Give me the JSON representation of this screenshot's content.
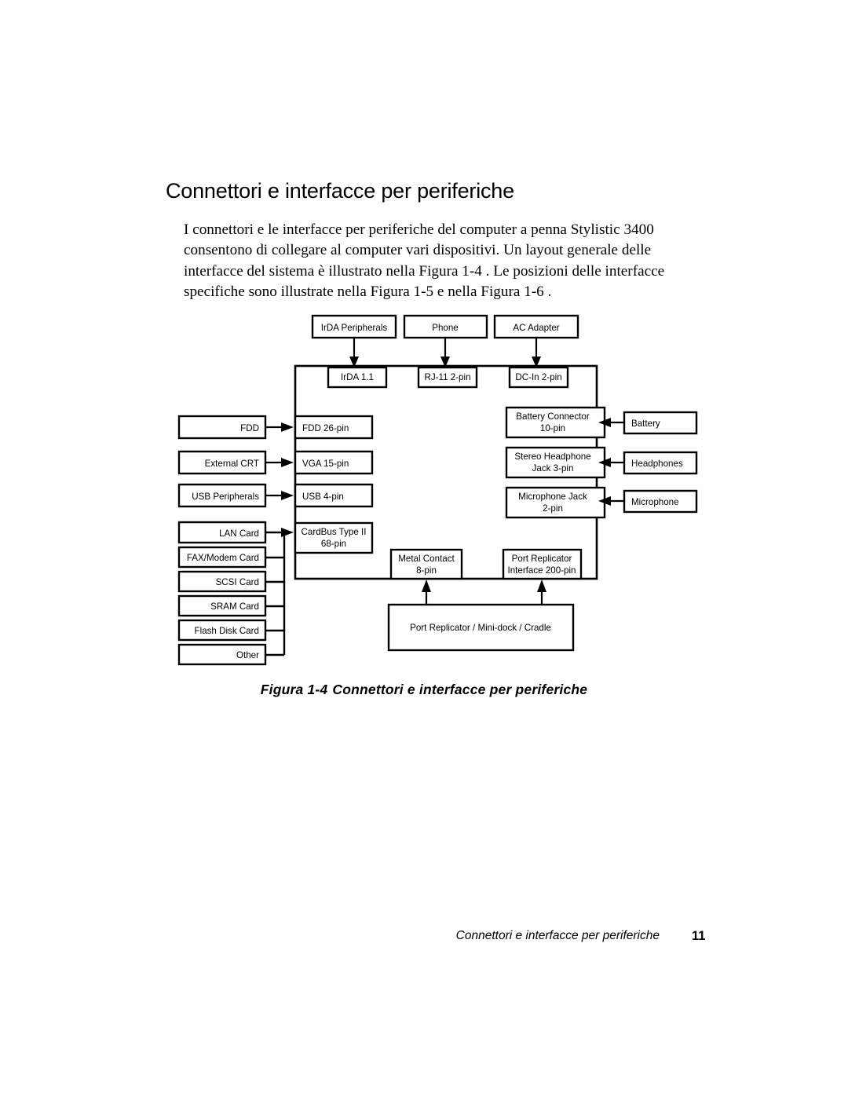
{
  "document": {
    "heading": "Connettori e interfacce per periferiche",
    "intro_paragraph": "I connettori e le interfacce per periferiche del computer a penna Stylistic 3400 consentono di collegare al computer vari dispositivi. Un layout generale delle interfacce del sistema è illustrato nella Figura 1-4 . Le posizioni delle interfacce specifiche sono illustrate nella Figura 1-5  e nella Figura 1-6 ."
  },
  "figure": {
    "caption_number": "Figura 1-4",
    "caption_text": "Connettori e interfacce per periferiche",
    "top_peripherals": [
      {
        "label": "IrDA Peripherals"
      },
      {
        "label": "Phone"
      },
      {
        "label": "AC Adapter"
      }
    ],
    "top_connectors": [
      {
        "label": "IrDA 1.1"
      },
      {
        "label": "RJ-11 2-pin"
      },
      {
        "label": "DC-In 2-pin"
      }
    ],
    "left_peripherals": [
      {
        "label": "FDD"
      },
      {
        "label": "External CRT"
      },
      {
        "label": "USB Peripherals"
      }
    ],
    "left_connectors": [
      {
        "label": "FDD 26-pin"
      },
      {
        "label": "VGA 15-pin"
      },
      {
        "label": "USB 4-pin"
      }
    ],
    "cardbus_connector": {
      "line1": "CardBus Type II",
      "line2": "68-pin"
    },
    "pc_cards": [
      {
        "label": "LAN Card"
      },
      {
        "label": "FAX/Modem Card"
      },
      {
        "label": "SCSI Card"
      },
      {
        "label": "SRAM Card"
      },
      {
        "label": "Flash Disk Card"
      },
      {
        "label": "Other"
      }
    ],
    "right_connectors": [
      {
        "line1": "Battery Connector",
        "line2": "10-pin"
      },
      {
        "line1": "Stereo Headphone",
        "line2": "Jack 3-pin"
      },
      {
        "line1": "Microphone Jack",
        "line2": "2-pin"
      }
    ],
    "right_peripherals": [
      {
        "label": "Battery"
      },
      {
        "label": "Headphones"
      },
      {
        "label": "Microphone"
      }
    ],
    "bottom_connectors": [
      {
        "line1": "Metal Contact",
        "line2": "8-pin"
      },
      {
        "line1": "Port Replicator",
        "line2": "Interface 200-pin"
      }
    ],
    "bottom_device": {
      "label": "Port Replicator / Mini-dock / Cradle"
    }
  },
  "footer": {
    "title": "Connettori e interfacce per periferiche",
    "page_number": "11"
  }
}
